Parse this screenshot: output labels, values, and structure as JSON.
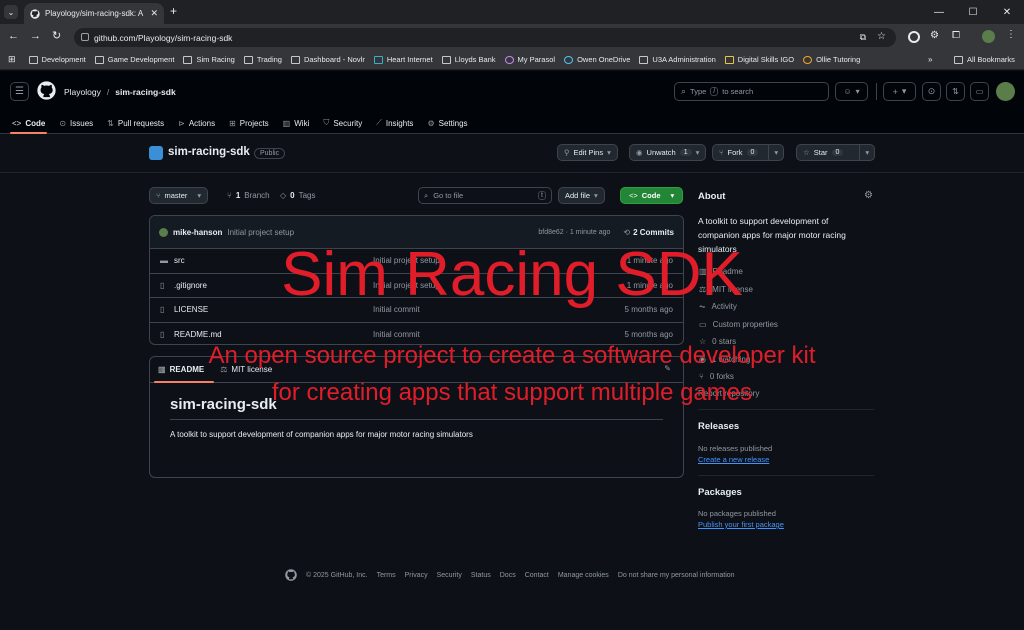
{
  "browser": {
    "tab_title": "Playology/sim-racing-sdk: A to",
    "url": "github.com/Playology/sim-racing-sdk",
    "bookmarks": [
      "Development",
      "Game Development",
      "Sim Racing",
      "Trading",
      "Dashboard - Novlr",
      "Heart Internet",
      "Lloyds Bank",
      "My Parasol",
      "Owen OneDrive",
      "U3A Administration",
      "Digital Skills IGO",
      "Ollie Tutoring"
    ],
    "all_bookmarks": "All Bookmarks"
  },
  "header": {
    "owner": "Playology",
    "separator": "/",
    "repo": "sim-racing-sdk",
    "search_pre": "Type",
    "search_key": "/",
    "search_post": "to search"
  },
  "nav": [
    {
      "label": "Code"
    },
    {
      "label": "Issues"
    },
    {
      "label": "Pull requests"
    },
    {
      "label": "Actions"
    },
    {
      "label": "Projects"
    },
    {
      "label": "Wiki"
    },
    {
      "label": "Security"
    },
    {
      "label": "Insights"
    },
    {
      "label": "Settings"
    }
  ],
  "repo": {
    "name": "sim-racing-sdk",
    "visibility": "Public",
    "edit_pins": "Edit Pins",
    "watch": "Unwatch",
    "watch_count": "1",
    "fork": "Fork",
    "fork_count": "0",
    "star": "Star",
    "star_count": "0"
  },
  "filebar": {
    "branch": "master",
    "branches_count": "1",
    "branches_label": "Branch",
    "tags_count": "0",
    "tags_label": "Tags",
    "goto_placeholder": "Go to file",
    "goto_key": "t",
    "add_file": "Add file",
    "code": "Code"
  },
  "commit": {
    "author": "mike-hanson",
    "message": "Initial project setup",
    "hash_time": "bfd8e62 · 1 minute ago",
    "commits": "2 Commits"
  },
  "files": [
    {
      "name": "src",
      "type": "folder",
      "message": "Initial project setup",
      "time": "1 minute ago"
    },
    {
      "name": ".gitignore",
      "type": "file",
      "message": "Initial project setup",
      "time": "1 minute ago"
    },
    {
      "name": "LICENSE",
      "type": "file",
      "message": "Initial commit",
      "time": "5 months ago"
    },
    {
      "name": "README.md",
      "type": "file",
      "message": "Initial commit",
      "time": "5 months ago"
    }
  ],
  "readme": {
    "tab_readme": "README",
    "tab_license": "MIT license",
    "heading": "sim-racing-sdk",
    "body": "A toolkit to support development of companion apps for major motor racing simulators"
  },
  "about": {
    "title": "About",
    "description": "A toolkit to support development of companion apps for major motor racing simulators",
    "items": [
      "Readme",
      "MIT license",
      "Activity",
      "Custom properties",
      "0 stars",
      "1 watching",
      "0 forks"
    ],
    "report": "Report repository"
  },
  "releases": {
    "title": "Releases",
    "none": "No releases published",
    "create": "Create a new release"
  },
  "packages": {
    "title": "Packages",
    "none": "No packages published",
    "publish": "Publish your first package"
  },
  "footer": {
    "copyright": "© 2025 GitHub, Inc.",
    "links": [
      "Terms",
      "Privacy",
      "Security",
      "Status",
      "Docs",
      "Contact",
      "Manage cookies",
      "Do not share my personal information"
    ]
  },
  "overlay": {
    "title": "Sim Racing SDK",
    "line1": "An open source project to create a software developer kit",
    "line2": "for creating apps that support multiple games"
  },
  "colors": {
    "accent": "#238636",
    "link": "#4493f8",
    "overlay_text": "#e11d2a",
    "nav_underline": "#f78166"
  }
}
